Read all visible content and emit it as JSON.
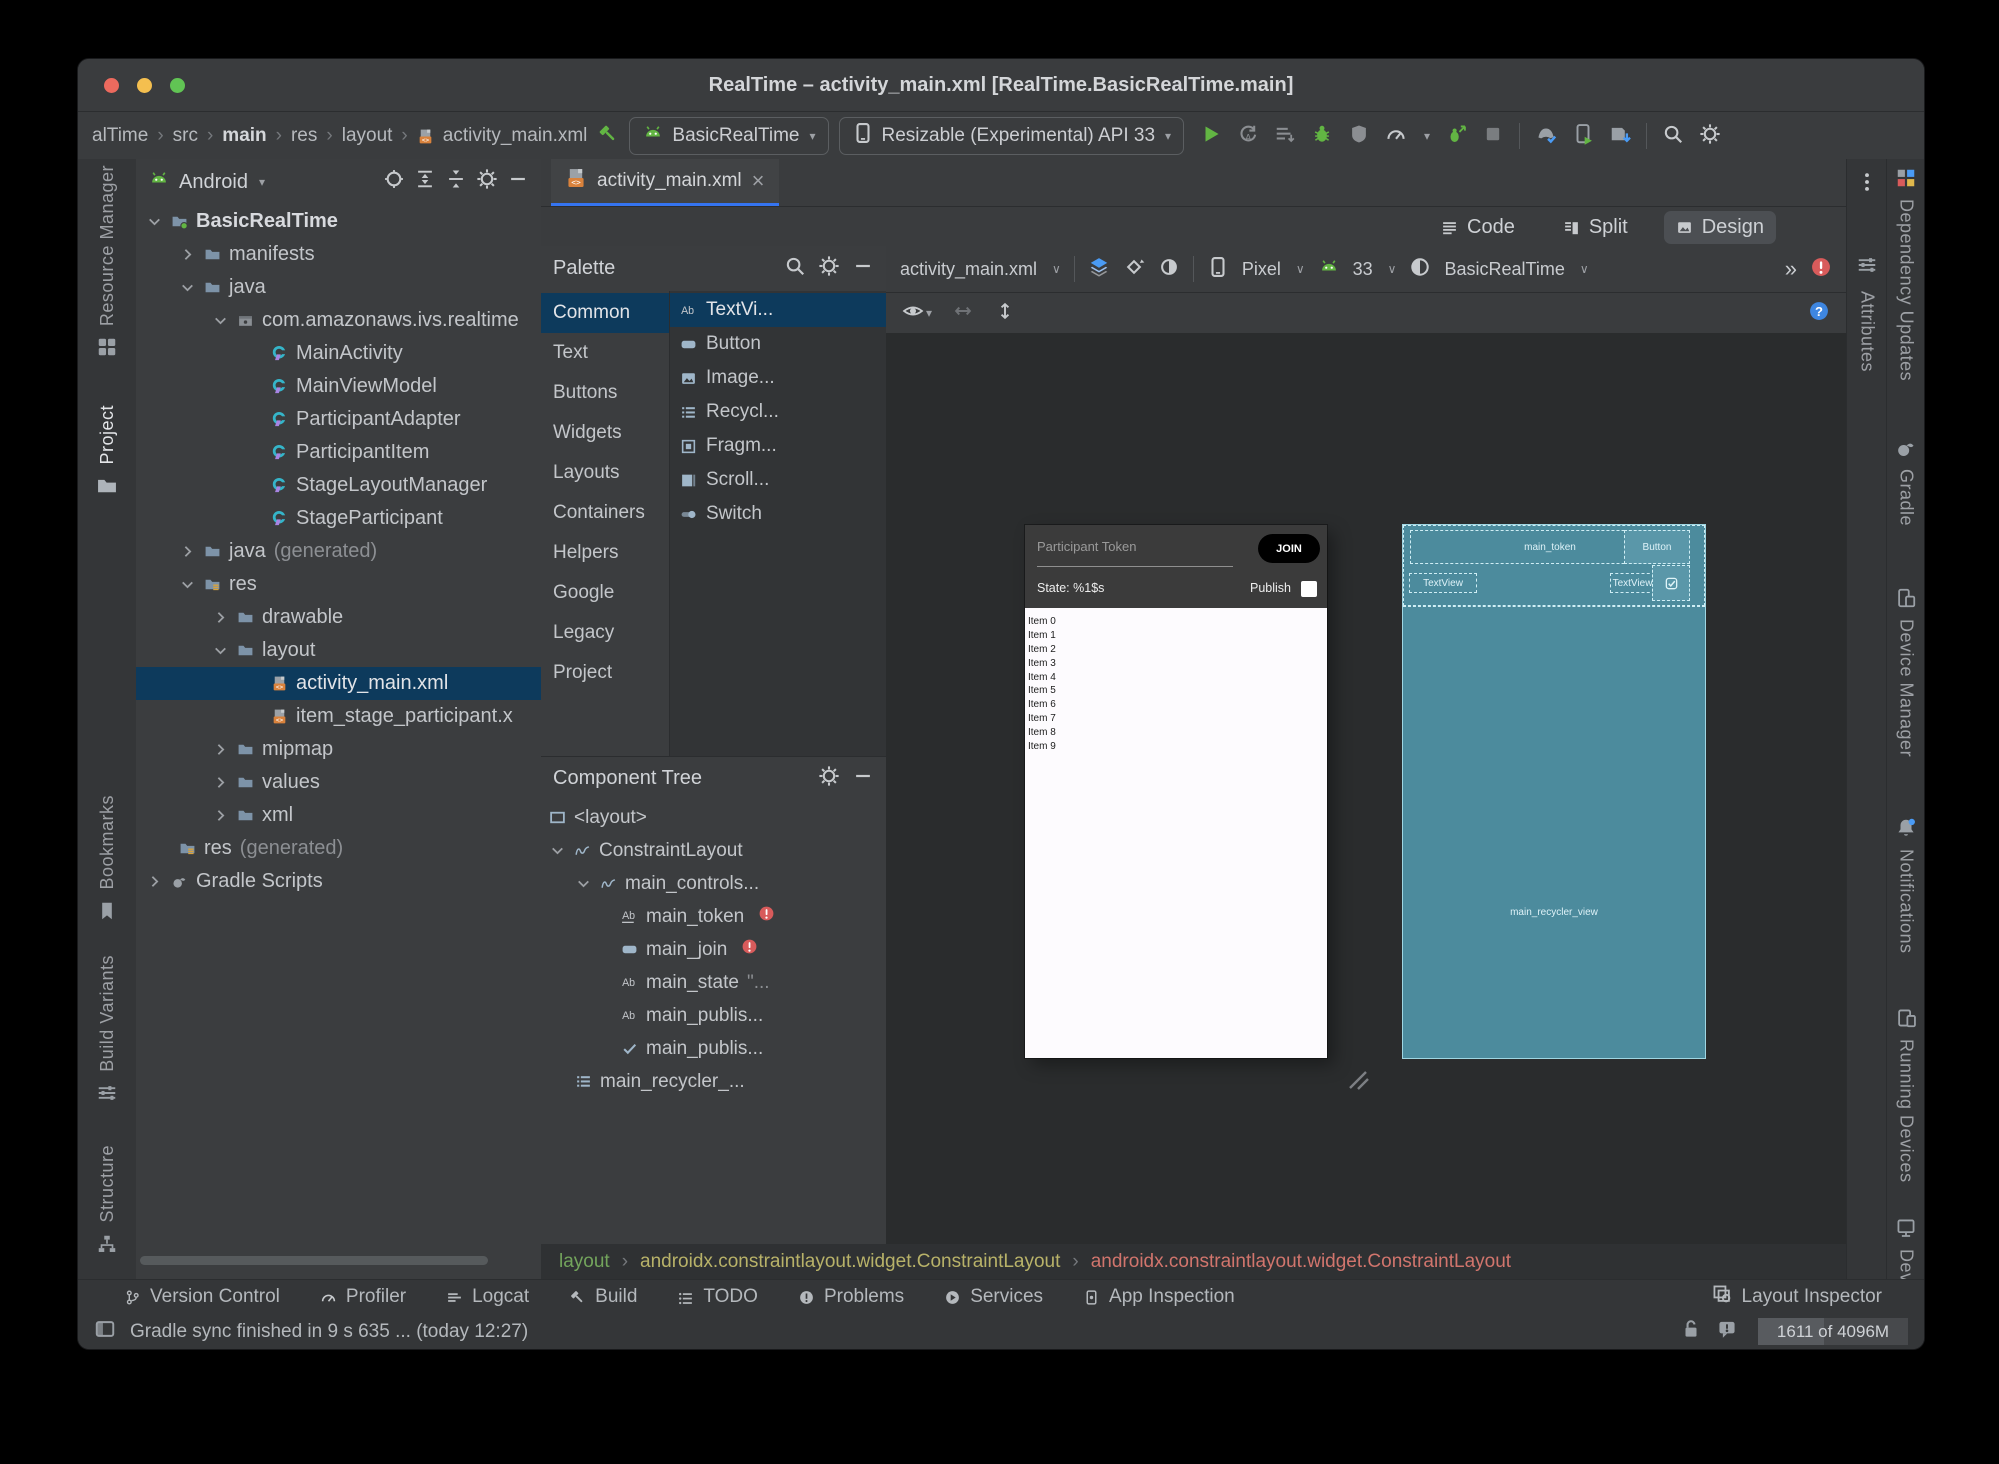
{
  "window": {
    "title": "RealTime – activity_main.xml [RealTime.BasicRealTime.main]"
  },
  "main_toolbar": {
    "breadcrumbs": [
      {
        "label": "alTime"
      },
      {
        "label": "src"
      },
      {
        "label": "main",
        "bold": true
      },
      {
        "label": "res"
      },
      {
        "label": "layout"
      },
      {
        "label": "activity_main.xml",
        "icon": "xml-file"
      }
    ],
    "run_config": "BasicRealTime",
    "device_config": "Resizable (Experimental) API 33",
    "actions": [
      "play",
      "apply-changes",
      "apply-code",
      "bug",
      "coverage",
      "gauge",
      "bug-arrow",
      "stop",
      "sep",
      "device-mirror",
      "phone-run",
      "sdk-download",
      "sep",
      "search",
      "gear"
    ]
  },
  "left_strip": [
    {
      "label": "Resource Manager",
      "icon": "resource-manager"
    },
    {
      "label": "Project",
      "icon": "project-folder",
      "active": true
    },
    {
      "label": "Bookmarks",
      "icon": "bookmark"
    },
    {
      "label": "Build Variants",
      "icon": "build-variants"
    },
    {
      "label": "Structure",
      "icon": "structure"
    }
  ],
  "project_panel": {
    "view": "Android",
    "tree": [
      {
        "chevron": "v",
        "icon": "folder-dot",
        "label": "BasicRealTime",
        "level": 0,
        "bold": true
      },
      {
        "chevron": ">",
        "icon": "folder",
        "label": "manifests",
        "level": 1
      },
      {
        "chevron": "v",
        "icon": "folder",
        "label": "java",
        "level": 1
      },
      {
        "chevron": "v",
        "icon": "package",
        "label": "com.amazonaws.ivs.realtime",
        "level": 2
      },
      {
        "icon": "kotlin",
        "label": "MainActivity",
        "level": 3
      },
      {
        "icon": "kotlin",
        "label": "MainViewModel",
        "level": 3
      },
      {
        "icon": "kotlin",
        "label": "ParticipantAdapter",
        "level": 3
      },
      {
        "icon": "kotlin",
        "label": "ParticipantItem",
        "level": 3
      },
      {
        "icon": "kotlin",
        "label": "StageLayoutManager",
        "level": 3
      },
      {
        "icon": "kotlin",
        "label": "StageParticipant",
        "level": 3
      },
      {
        "chevron": ">",
        "icon": "folder",
        "label": "java",
        "suffix": " (generated)",
        "level": 1
      },
      {
        "chevron": "v",
        "icon": "res-folder",
        "label": "res",
        "level": 1
      },
      {
        "chevron": ">",
        "icon": "folder",
        "label": "drawable",
        "level": 2
      },
      {
        "chevron": "v",
        "icon": "folder",
        "label": "layout",
        "level": 2
      },
      {
        "icon": "xml-file",
        "label": "activity_main.xml",
        "level": 3,
        "selected": true
      },
      {
        "icon": "xml-file",
        "label": "item_stage_participant.x",
        "level": 3
      },
      {
        "chevron": ">",
        "icon": "folder",
        "label": "mipmap",
        "level": 2
      },
      {
        "chevron": ">",
        "icon": "folder",
        "label": "values",
        "level": 2
      },
      {
        "chevron": ">",
        "icon": "folder",
        "label": "xml",
        "level": 2
      },
      {
        "icon": "res-folder",
        "label": "res",
        "suffix": " (generated)",
        "level": 1,
        "noslot": true
      },
      {
        "chevron": ">",
        "icon": "gradle",
        "label": "Gradle Scripts",
        "level": 0
      }
    ]
  },
  "editor": {
    "tab": "activity_main.xml",
    "modes": [
      {
        "icon": "code-mode",
        "label": "Code"
      },
      {
        "icon": "split-mode",
        "label": "Split"
      },
      {
        "icon": "design-mode",
        "label": "Design",
        "active": true
      }
    ]
  },
  "palette": {
    "title": "Palette",
    "categories": [
      "Common",
      "Text",
      "Buttons",
      "Widgets",
      "Layouts",
      "Containers",
      "Helpers",
      "Google",
      "Legacy",
      "Project"
    ],
    "selected_category": "Common",
    "items": [
      {
        "icon": "ab",
        "label": "TextVi...",
        "selected": true
      },
      {
        "icon": "button-widget",
        "label": "Button"
      },
      {
        "icon": "image",
        "label": "Image..."
      },
      {
        "icon": "recycler",
        "label": "Recycl..."
      },
      {
        "icon": "fragment",
        "label": "Fragm..."
      },
      {
        "icon": "scrollview",
        "label": "Scroll..."
      },
      {
        "icon": "switch",
        "label": "Switch"
      }
    ]
  },
  "component_tree": {
    "title": "Component Tree",
    "rows": [
      {
        "icon": "layout-rect",
        "label": "<layout>",
        "level": 0,
        "noslot": true
      },
      {
        "chevron": "v",
        "icon": "spring",
        "label": "ConstraintLayout",
        "level": 0
      },
      {
        "chevron": "v",
        "icon": "spring",
        "label": "main_controls...",
        "level": 1
      },
      {
        "icon": "ab-underline",
        "label": "main_token",
        "level": 2,
        "badge": "error"
      },
      {
        "icon": "button-widget",
        "label": "main_join",
        "level": 2,
        "badge": "error"
      },
      {
        "icon": "ab",
        "label": "main_state",
        "level": 2,
        "suffix": "\"..."
      },
      {
        "icon": "ab",
        "label": "main_publis...",
        "level": 2
      },
      {
        "icon": "checkbox-widget",
        "label": "main_publis...",
        "level": 2
      },
      {
        "icon": "recycler",
        "label": "main_recycler_...",
        "level": 1,
        "noslot": true
      }
    ]
  },
  "design": {
    "toolbar": {
      "file": "activity_main.xml",
      "device_label": "Pixel",
      "api_label": "33",
      "theme_label": "BasicRealTime",
      "overflow": "»"
    },
    "phone": {
      "hint": "Participant Token",
      "join_label": "JOIN",
      "state_label": "State: %1$s",
      "publish_label": "Publish",
      "list_items": [
        "Item 0",
        "Item 1",
        "Item 2",
        "Item 3",
        "Item 4",
        "Item 5",
        "Item 6",
        "Item 7",
        "Item 8",
        "Item 9"
      ]
    },
    "blueprint": {
      "token_label": "main_token",
      "button_label": "Button",
      "textview_left": "TextView",
      "textview_right": "TextView",
      "recycler_label": "main_recycler_view"
    }
  },
  "xml_breadcrumbs": [
    {
      "label": "layout",
      "color": "#73a45c"
    },
    {
      "label": "androidx.constraintlayout.widget.ConstraintLayout",
      "color": "#b8b269"
    },
    {
      "label": "androidx.constraintlayout.widget.ConstraintLayout",
      "color": "#d1756d"
    }
  ],
  "bottom_bar": {
    "items": [
      {
        "icon": "vc-branch",
        "label": "Version Control"
      },
      {
        "icon": "gauge",
        "label": "Profiler"
      },
      {
        "icon": "logcat",
        "label": "Logcat"
      },
      {
        "icon": "hammer",
        "label": "Build"
      },
      {
        "icon": "todo-list",
        "label": "TODO"
      },
      {
        "icon": "problems",
        "label": "Problems"
      },
      {
        "icon": "services",
        "label": "Services"
      },
      {
        "icon": "app-inspection",
        "label": "App Inspection"
      }
    ],
    "right": "Layout Inspector"
  },
  "status_bar": {
    "message": "Gradle sync finished in 9 s 635 ... (today 12:27)",
    "memory": "1611 of 4096M"
  },
  "right_panel": {
    "inner_tab": "Attributes",
    "outer_tabs": [
      {
        "icon": "dependency-updates",
        "label": "Dependency Updates"
      },
      {
        "icon": "gradle",
        "label": "Gradle"
      },
      {
        "icon": "device-manager",
        "label": "Device Manager"
      },
      {
        "icon": "notifications",
        "label": "Notifications"
      },
      {
        "icon": "running-devices",
        "label": "Running Devices"
      },
      {
        "icon": "device-file-explorer",
        "label": "Device File E"
      }
    ]
  },
  "colors": {
    "accent": "#3574f0",
    "error": "#d85b5b",
    "blueprint_fill": "#4c8b9d",
    "selection": "#0d3a5c"
  }
}
